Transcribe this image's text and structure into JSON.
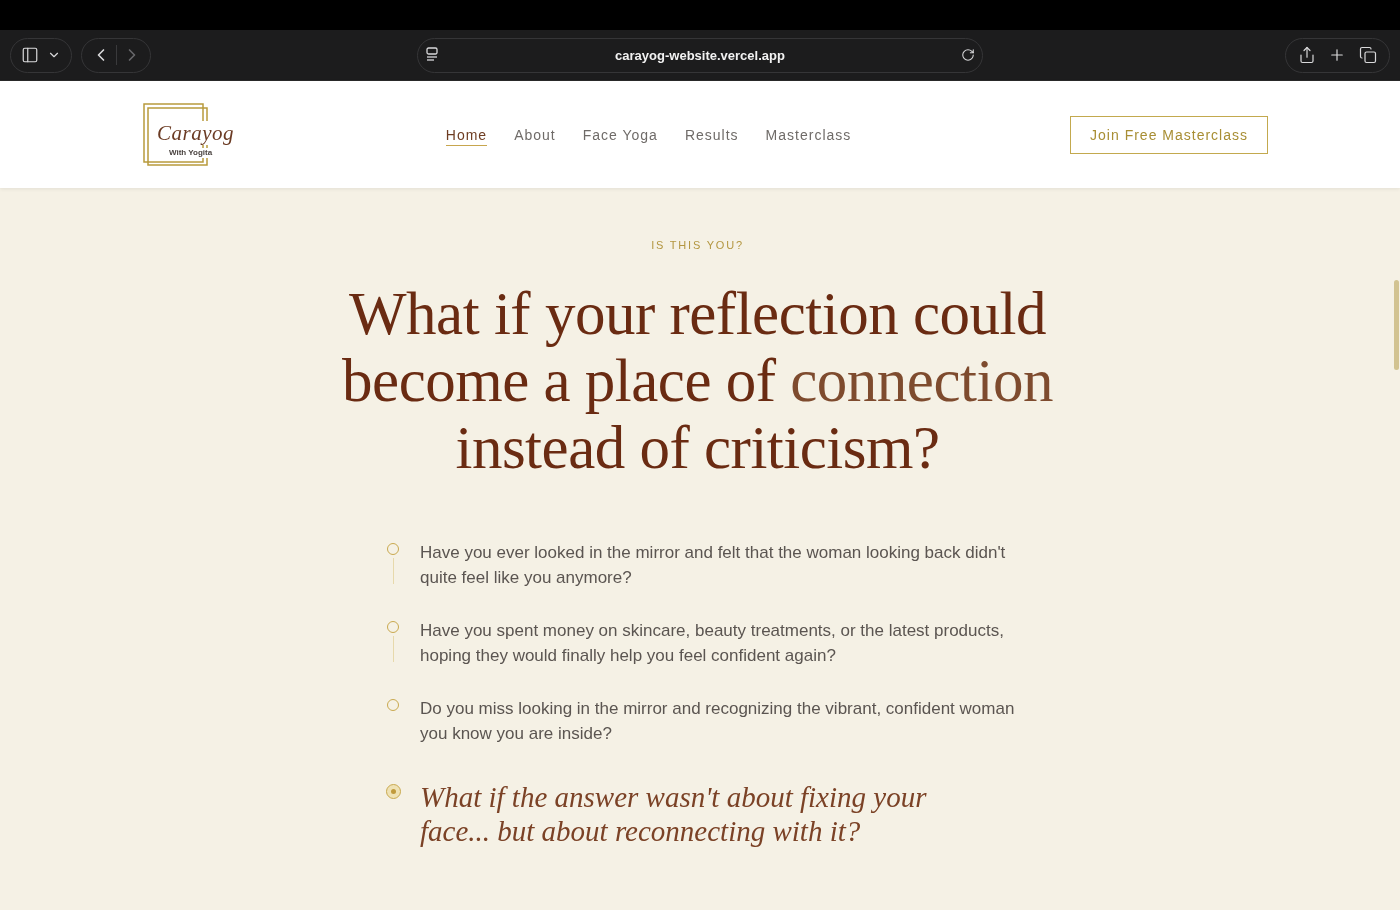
{
  "browser": {
    "url": "carayog-website.vercel.app",
    "back": {
      "disabled": false
    },
    "forward": {
      "disabled": true
    }
  },
  "header": {
    "logo": {
      "name": "Carayog",
      "tagline": "With Yogita"
    },
    "nav": [
      {
        "label": "Home",
        "selected": true
      },
      {
        "label": "About",
        "selected": false
      },
      {
        "label": "Face Yoga",
        "selected": false
      },
      {
        "label": "Results",
        "selected": false
      },
      {
        "label": "Masterclass",
        "selected": false
      }
    ],
    "cta": "Join Free Masterclass"
  },
  "section": {
    "eyebrow": "IS THIS YOU?",
    "heading": [
      {
        "text": "What if your reflection could become a place of ",
        "accent": false
      },
      {
        "text": "connection",
        "accent": true
      },
      {
        "text": " instead of criticism?",
        "accent": false
      }
    ],
    "items": [
      {
        "kind": "question",
        "text": "Have you ever looked in the mirror and felt that the woman looking back didn't quite feel like you anymore?"
      },
      {
        "kind": "question",
        "text": "Have you spent money on skincare, beauty treatments, or the latest products, hoping they would finally help you feel confident again?"
      },
      {
        "kind": "question",
        "text": "Do you miss looking in the mirror and recognizing the vibrant, confident woman you know you are inside?"
      },
      {
        "kind": "answer",
        "text": "What if the answer wasn't about fixing your face... but about reconnecting with it?"
      }
    ]
  }
}
